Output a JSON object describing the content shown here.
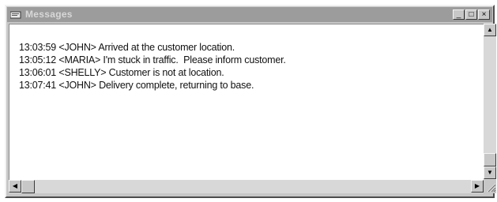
{
  "window": {
    "title": "Messages",
    "controls": {
      "minimize": "_",
      "maximize": "□",
      "close": "×"
    }
  },
  "messages": [
    {
      "time": "13:03:59",
      "sender": "<JOHN>",
      "text": "Arrived at the customer location."
    },
    {
      "time": "13:05:12",
      "sender": "<MARIA>",
      "text": "I'm stuck in traffic.  Please inform customer."
    },
    {
      "time": "13:06:01",
      "sender": "<SHELLY>",
      "text": "Customer is not at location."
    },
    {
      "time": "13:07:41",
      "sender": "<JOHN>",
      "text": "Delivery complete, returning to base."
    }
  ],
  "icons": {
    "app": "messages-app-icon",
    "scroll_up": "▲",
    "scroll_down": "▼",
    "scroll_left": "◀",
    "scroll_right": "▶"
  }
}
